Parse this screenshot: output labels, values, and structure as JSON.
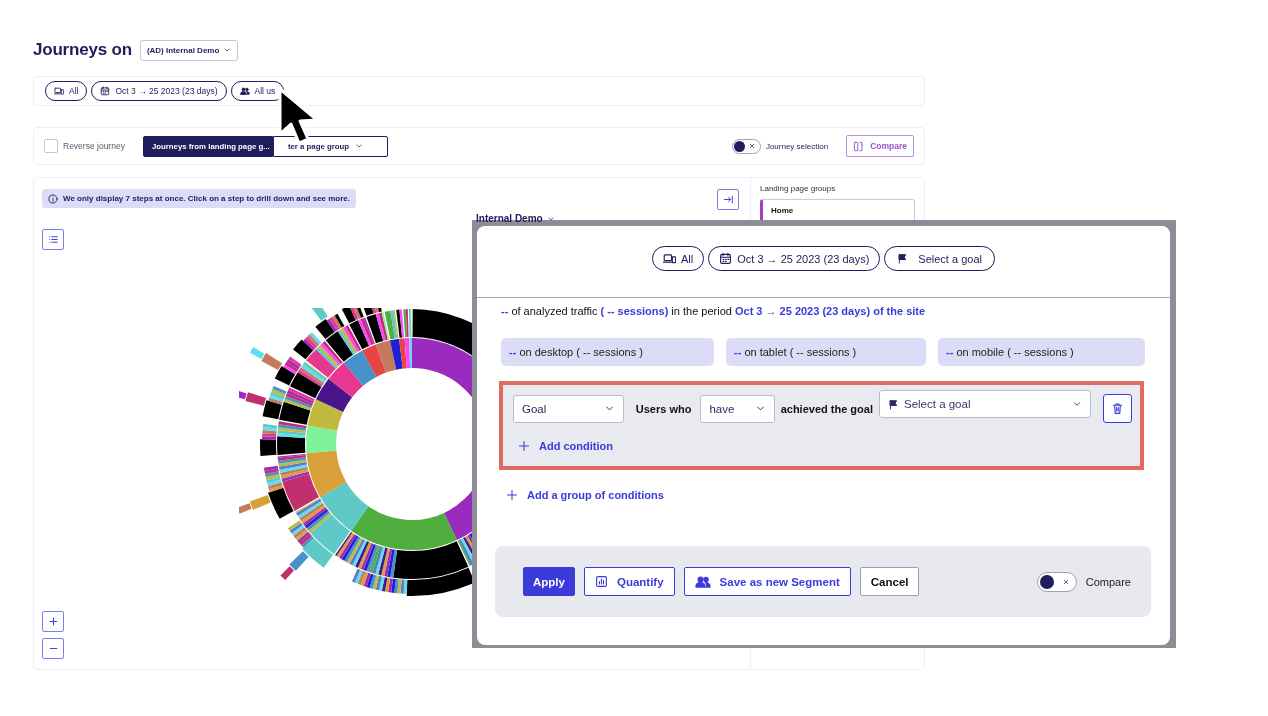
{
  "header": {
    "title": "Journeys on",
    "site_dropdown": "(AD) Internal Demo"
  },
  "filter_bar": {
    "chips": [
      {
        "kind": "device",
        "label": "All"
      },
      {
        "kind": "date",
        "label": "Oct 3 → 25 2023 (23 days)"
      },
      {
        "kind": "users",
        "label": "All us"
      }
    ]
  },
  "toolbar": {
    "reverse_journey": {
      "label": "Reverse journey",
      "checked": false
    },
    "modes": [
      {
        "label": "Journeys from landing page g...",
        "selected": true
      },
      {
        "label": "ter a page group",
        "selected": false
      }
    ],
    "journey_selection": {
      "label": "Journey selection",
      "on": false
    },
    "compare_button": "Compare"
  },
  "journey_panel": {
    "notice": "We only display 7 steps at once. Click on a step to drill down and see more.",
    "breadcrumb": "Internal Demo",
    "sidebar": {
      "title": "Landing page groups",
      "items": [
        {
          "label": "Home",
          "selected": true
        }
      ]
    }
  },
  "segment_modal": {
    "chips": [
      {
        "kind": "device",
        "label": "All"
      },
      {
        "kind": "date",
        "label": "Oct 3 → 25 2023 (23 days)"
      },
      {
        "kind": "goal",
        "label": "Select a goal"
      }
    ],
    "summary": "**--** of analyzed traffic **( -- sessions)** in the period **Oct 3 → 25 2023 (23 days) of the site**",
    "breakdown": [
      "**--** on desktop ( -- sessions )",
      "**--** on tablet ( -- sessions )",
      "**--** on mobile ( -- sessions )"
    ],
    "condition_group": {
      "highlighted": true,
      "conditions": [
        {
          "type_select": "Goal",
          "label_before": "Users who",
          "verb_select": "have",
          "label_after": "achieved the goal",
          "goal_select": {
            "placeholder": "Select a goal"
          }
        }
      ],
      "add_condition": "Add condition"
    },
    "add_group": "Add a group of conditions",
    "footer": {
      "buttons": [
        {
          "kind": "primary",
          "label": "Apply"
        },
        {
          "kind": "quantify",
          "label": "Quantify"
        },
        {
          "kind": "segment",
          "label": "Save as new Segment"
        },
        {
          "kind": "plain",
          "label": "Cancel"
        }
      ],
      "compare_toggle": {
        "label": "Compare",
        "on": false
      }
    }
  }
}
